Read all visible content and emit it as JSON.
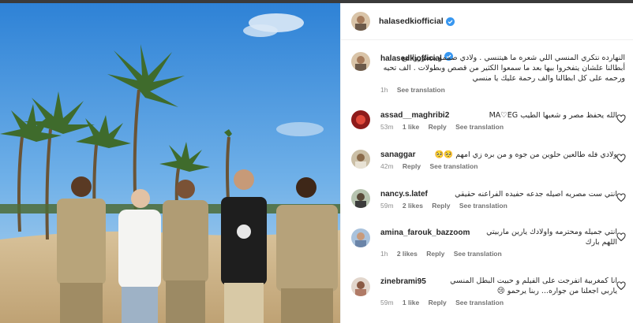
{
  "post": {
    "username": "halasedkiofficial",
    "caption": "النهارده نتكري المنسي اللي شعره ما هيتنسي . ولادي صممو يتصوروا مع أبطالنا علشان يتفخروا بيها بعد ما سمعوا الكثير من قصص وبطولات . الف تحيه ورحمه على كل ابطالنا والف رحمة عليك يا منسي",
    "caption_time": "1h",
    "see_translation": "See translation"
  },
  "comments": [
    {
      "user": "assad__maghribi2",
      "text": "الله يحفظ مصر و شعبها الطيب MA♡EG",
      "time": "53m",
      "likes": "1 like",
      "reply": "Reply",
      "translate": "See translation"
    },
    {
      "user": "sanaggar",
      "text": "ولادي فله طالعين حلوين من جوه و من بره زي امهم 🥺🥺",
      "time": "42m",
      "likes": "",
      "reply": "Reply",
      "translate": "See translation"
    },
    {
      "user": "nancy.s.latef",
      "text": "انتي ست مصريه اصيله جدعه حفيده الفراعنه حقيقي",
      "time": "59m",
      "likes": "2 likes",
      "reply": "Reply",
      "translate": "See translation"
    },
    {
      "user": "amina_farouk_bazzoom",
      "text": "انتي جميله ومحترمه واولادك يارين ماربيتي اللهم بارك",
      "time": "1h",
      "likes": "2 likes",
      "reply": "Reply",
      "translate": "See translation"
    },
    {
      "user": "zinebrami95",
      "text": "انا كمغربية اتفرجت على الفيلم و حبيت البطل المنسي ياربي اجعلنا من جواره... ربنا يرحمو 😢",
      "time": "59m",
      "likes": "1 like",
      "reply": "Reply",
      "translate": "See translation"
    }
  ],
  "colors": {
    "verified": "#3897f0",
    "sky": "#3f8fd9",
    "sand": "#c9b28a"
  }
}
